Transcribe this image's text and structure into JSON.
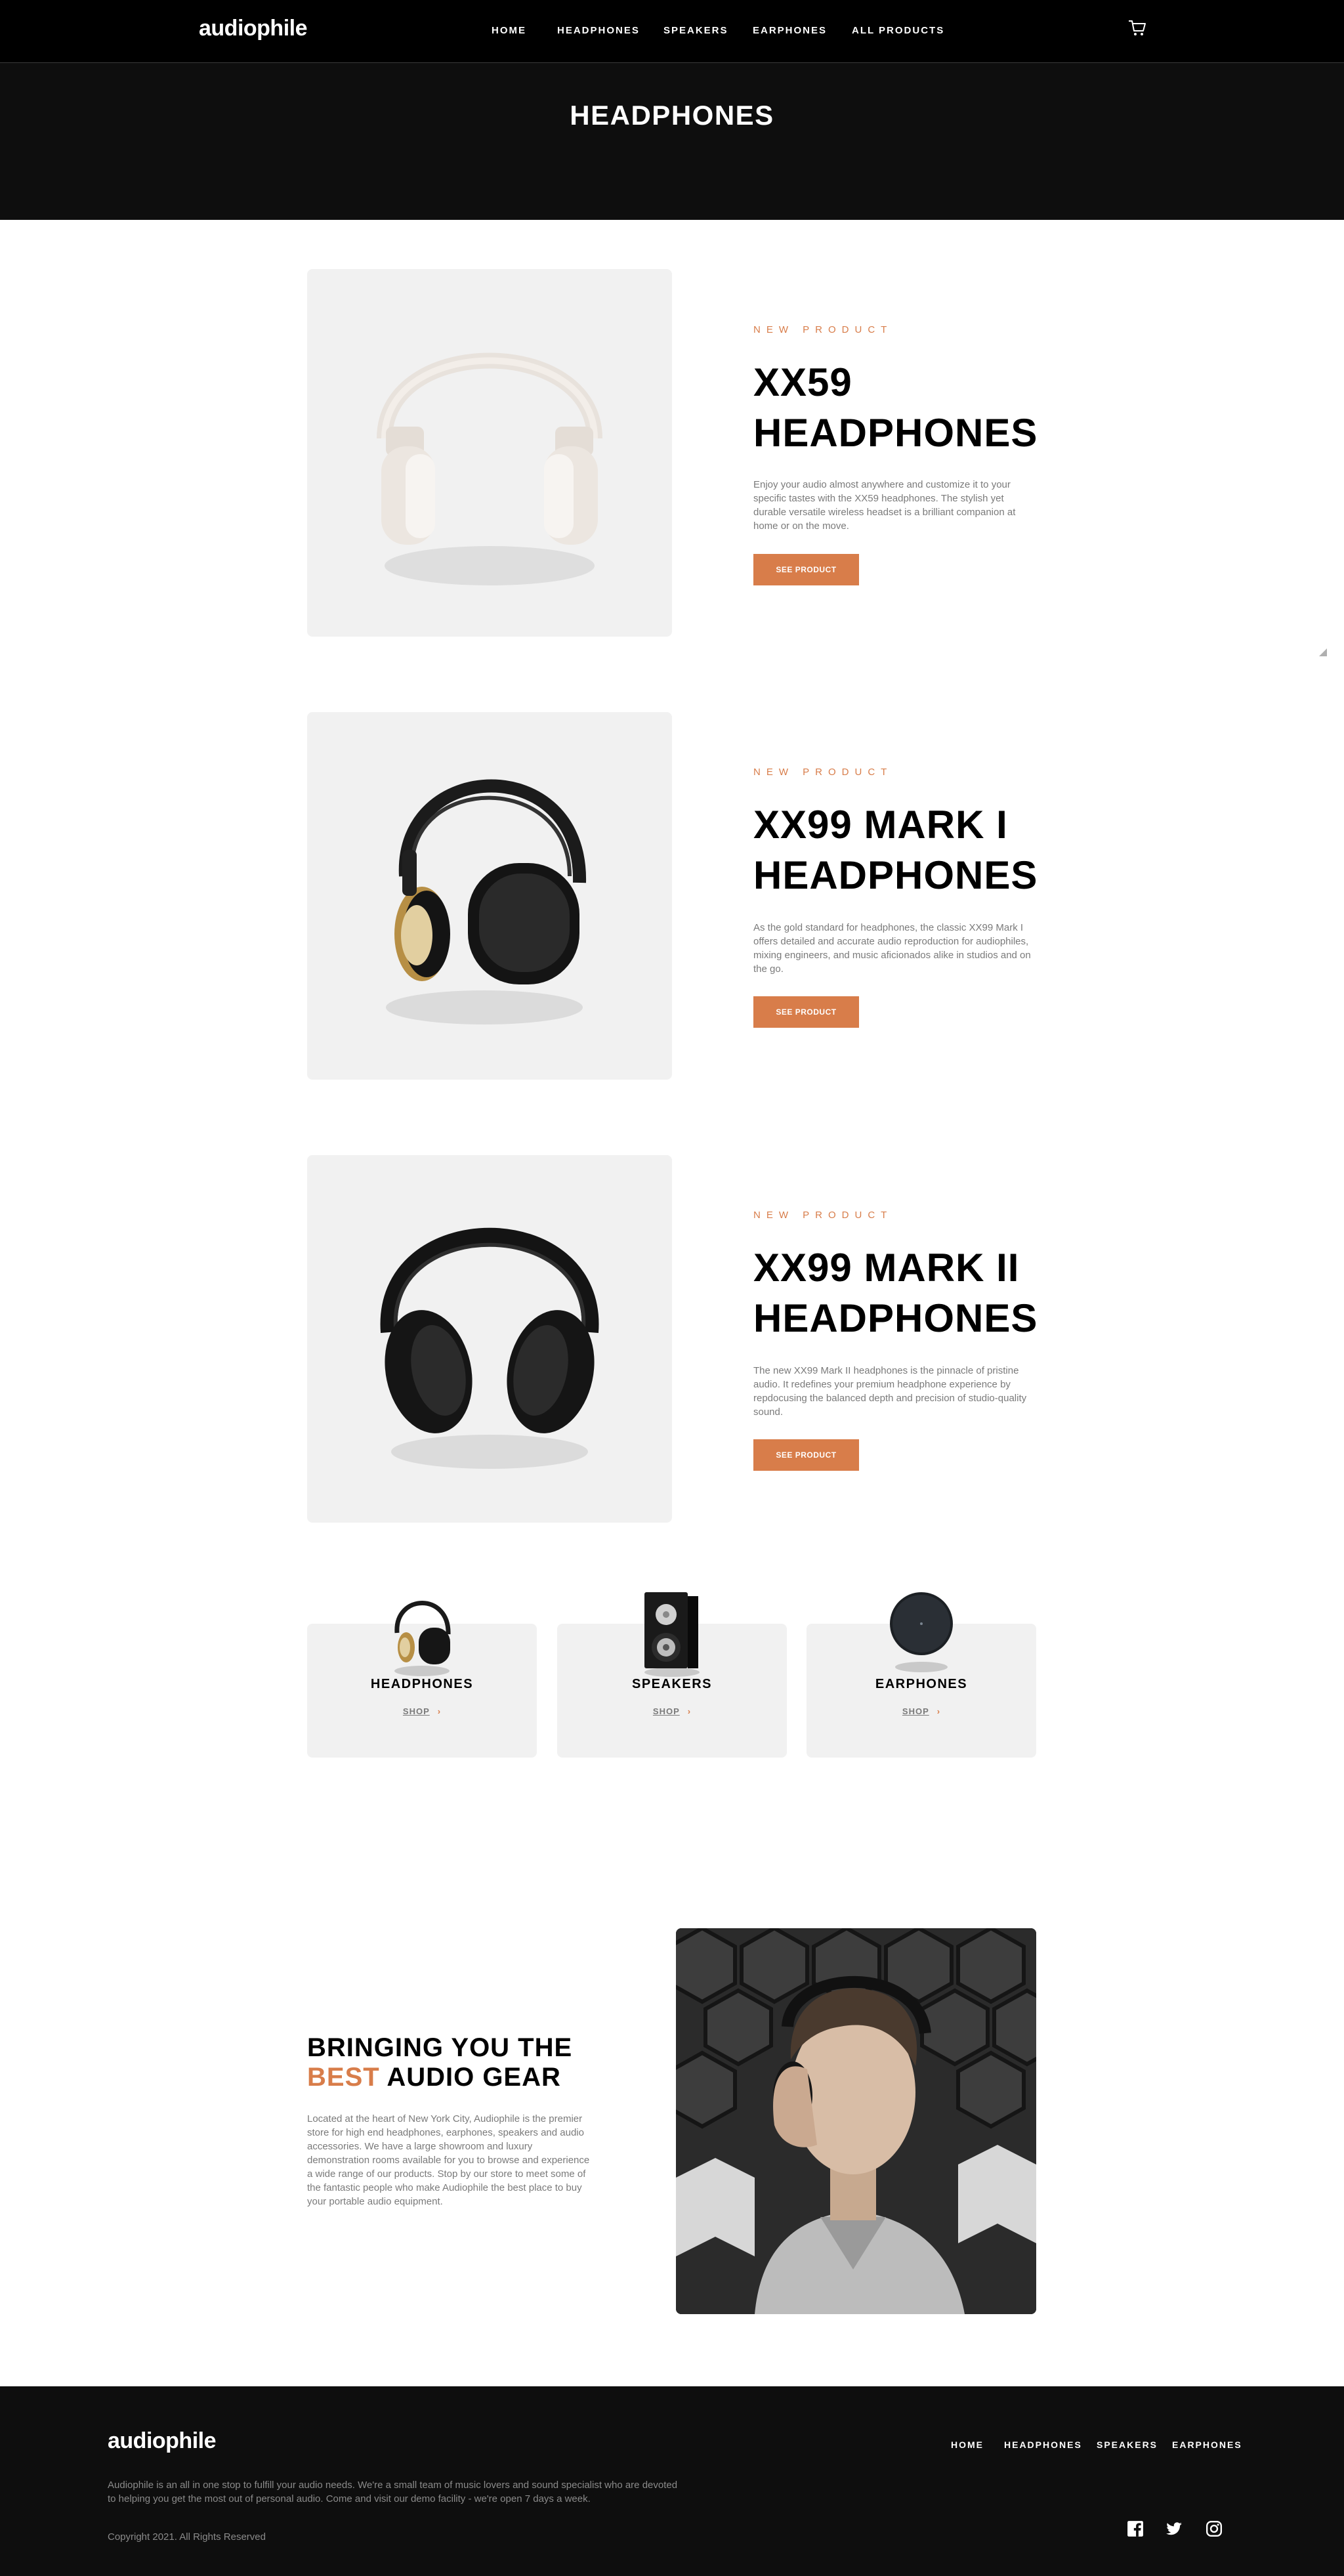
{
  "nav": {
    "logo": "audiophile",
    "links": [
      "HOME",
      "HEADPHONES",
      "SPEAKERS",
      "EARPHONES",
      "ALL PRODUCTS"
    ],
    "cart_icon": "cart-icon"
  },
  "page_title": "HEADPHONES",
  "products": [
    {
      "eyebrow": "NEW PRODUCT",
      "name_line1": "XX59",
      "name_line2": "HEADPHONES",
      "description": "Enjoy your audio almost anywhere and customize it to your specific tastes with the XX59 headphones. The stylish yet durable versatile wireless headset is a brilliant companion at home or on the move.",
      "button": "SEE PRODUCT"
    },
    {
      "eyebrow": "NEW PRODUCT",
      "name_line1": "XX99 MARK I",
      "name_line2": "HEADPHONES",
      "description": "As the gold standard for headphones, the classic XX99 Mark I offers detailed and accurate audio reproduction for audiophiles, mixing engineers, and music aficionados alike in studios and on the go.",
      "button": "SEE PRODUCT"
    },
    {
      "eyebrow": "NEW PRODUCT",
      "name_line1": "XX99 MARK II",
      "name_line2": "HEADPHONES",
      "description": "The new XX99 Mark II headphones is the pinnacle of pristine audio. It redefines your premium headphone experience by repdocusing the balanced depth and precision of studio-quality sound.",
      "button": "SEE PRODUCT"
    }
  ],
  "categories": [
    {
      "title": "HEADPHONES",
      "shop": "SHOP"
    },
    {
      "title": "SPEAKERS",
      "shop": "SHOP"
    },
    {
      "title": "EARPHONES",
      "shop": "SHOP"
    }
  ],
  "about": {
    "title_line1": "BRINGING YOU THE",
    "title_accent": "BEST",
    "title_rest": " AUDIO GEAR",
    "text": "Located at the heart of New York City, Audiophile is the premier store for high end headphones, earphones, speakers and audio accessories. We have a large showroom and luxury demonstration rooms available for you to browse and experience a wide range of our products. Stop by our store to meet some of the fantastic people who make Audiophile the best place to buy your portable audio equipment."
  },
  "footer": {
    "logo": "audiophile",
    "links": [
      "HOME",
      "HEADPHONES",
      "SPEAKERS",
      "EARPHONES"
    ],
    "description": "Audiophile is an all in one stop to fulfill your audio needs. We're a small team of music lovers and sound specialist who are devoted to helping you get the most out of personal audio. Come and visit our demo facility - we're open 7 days a week.",
    "copyright": "Copyright 2021. All Rights Reserved",
    "social_icons": [
      "facebook-icon",
      "twitter-icon",
      "instagram-icon"
    ]
  },
  "colors": {
    "accent": "#d87d4a",
    "dark": "#0e0e0e",
    "light_gray": "#f1f1f1"
  }
}
